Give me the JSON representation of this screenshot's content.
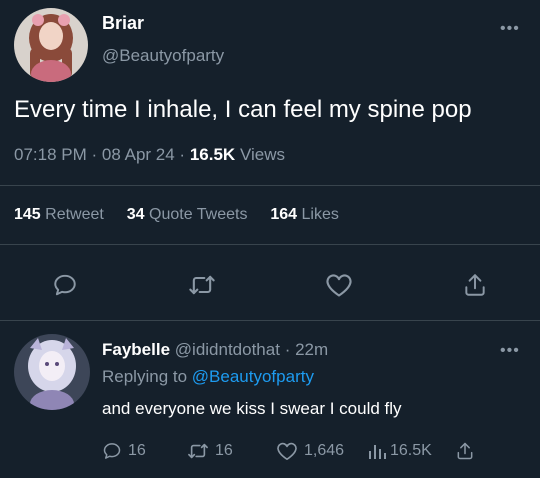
{
  "tweet": {
    "display_name": "Briar",
    "handle": "@Beautyofparty",
    "text": "Every time I inhale, I can feel my spine pop",
    "time": "07:18 PM",
    "date": "08 Apr 24",
    "views_count": "16.5K",
    "views_label": "Views",
    "sep": "·"
  },
  "stats": {
    "retweets": "145",
    "retweets_label": "Retweet",
    "quotes": "34",
    "quotes_label": "Quote Tweets",
    "likes": "164",
    "likes_label": "Likes"
  },
  "actions": [
    "reply-icon",
    "retweet-icon",
    "heart-icon",
    "share-icon"
  ],
  "reply": {
    "display_name": "Faybelle",
    "handle": "@ididntdothat",
    "sep": "·",
    "age": "22m",
    "replying_prefix": "Replying to",
    "replying_to": "@Beautyofparty",
    "text": "and everyone we kiss I swear I could fly",
    "replies": "16",
    "retweets": "16",
    "likes": "1,646",
    "views": "16.5K"
  },
  "colors": {
    "background": "#15202b",
    "text": "#ffffff",
    "muted": "#8b98a5",
    "accent": "#1d9bf0",
    "divider": "#38444d"
  }
}
